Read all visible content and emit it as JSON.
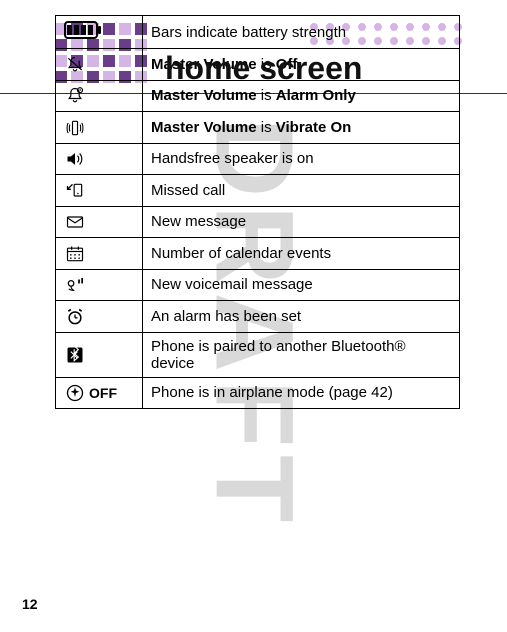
{
  "page": {
    "title": "home screen",
    "number": "12",
    "watermark": "DRAFT"
  },
  "rows": [
    {
      "icon": "battery",
      "text_parts": [
        {
          "t": "Bars indicate battery strength",
          "cls": ""
        }
      ]
    },
    {
      "icon": "bell-off",
      "text_parts": [
        {
          "t": "Master Volume",
          "cls": "bold-narrow"
        },
        {
          "t": " is ",
          "cls": ""
        },
        {
          "t": "Off",
          "cls": "bold-narrow"
        }
      ]
    },
    {
      "icon": "bell-alarm",
      "text_parts": [
        {
          "t": "Master Volume",
          "cls": "bold-narrow"
        },
        {
          "t": " is ",
          "cls": ""
        },
        {
          "t": "Alarm Only",
          "cls": "bold-narrow"
        }
      ]
    },
    {
      "icon": "vibrate",
      "text_parts": [
        {
          "t": "Master Volume",
          "cls": "bold-narrow"
        },
        {
          "t": " is ",
          "cls": ""
        },
        {
          "t": "Vibrate On",
          "cls": "bold-narrow"
        }
      ]
    },
    {
      "icon": "speaker",
      "text_parts": [
        {
          "t": "Handsfree speaker is on",
          "cls": ""
        }
      ]
    },
    {
      "icon": "missed-call",
      "text_parts": [
        {
          "t": "Missed call",
          "cls": ""
        }
      ]
    },
    {
      "icon": "envelope",
      "text_parts": [
        {
          "t": "New message",
          "cls": ""
        }
      ]
    },
    {
      "icon": "calendar",
      "text_parts": [
        {
          "t": "Number of calendar events",
          "cls": ""
        }
      ]
    },
    {
      "icon": "voicemail",
      "text_parts": [
        {
          "t": "New voicemail message",
          "cls": ""
        }
      ]
    },
    {
      "icon": "alarm-clock",
      "text_parts": [
        {
          "t": "An alarm has been set",
          "cls": ""
        }
      ]
    },
    {
      "icon": "bluetooth",
      "text_parts": [
        {
          "t": "Phone is paired to another Bluetooth® device",
          "cls": ""
        }
      ]
    },
    {
      "icon": "airplane",
      "extra_label": "OFF",
      "text_parts": [
        {
          "t": "Phone is in airplane mode (page 42)",
          "cls": ""
        }
      ]
    }
  ]
}
